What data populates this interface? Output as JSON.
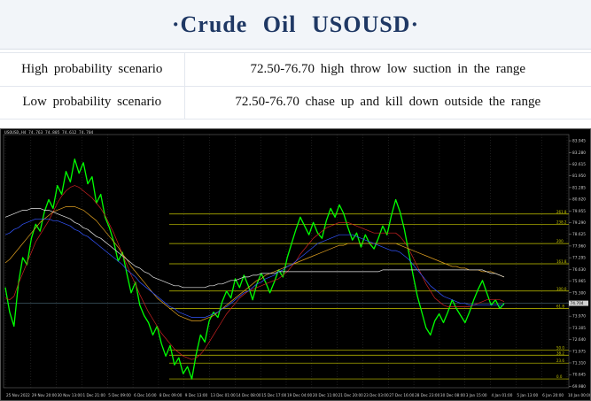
{
  "header": {
    "title": "·Crude Oil USOUSD·"
  },
  "scenarios": [
    {
      "label": "High probability scenario",
      "value": "72.50-76.70 high throw low suction in the range"
    },
    {
      "label": "Low probability scenario",
      "value": "72.50-76.70 chase up and kill down outside the range"
    }
  ],
  "chart_data": {
    "type": "line",
    "header_text": "USOUSD,H4 74.763 74.805 74.612 74.704",
    "colors": {
      "background": "#000000",
      "price": "#00ff00",
      "ma_red": "#cc2222",
      "ma_blue": "#3355ff",
      "ma_orange": "#e0a020",
      "ma_white": "#e8e8e8",
      "fib": "#c8c800",
      "grid": "#3a3a3a",
      "current_price": "#4a6a7a"
    },
    "ylim": [
      69.9,
      84.3
    ],
    "y_ticks": [
      "83.945",
      "83.280",
      "82.615",
      "81.950",
      "81.285",
      "80.620",
      "79.955",
      "79.290",
      "78.625",
      "77.960",
      "77.295",
      "76.630",
      "75.965",
      "75.300",
      "74.635",
      "73.970",
      "73.305",
      "72.640",
      "71.975",
      "71.310",
      "70.645",
      "69.980"
    ],
    "current_price": 74.704,
    "x_ticks": [
      "25 Nov 2022",
      "29 Nov 20:00",
      "30 Nov 13:00",
      "1 Dec 21:00",
      "5 Dec 09:00",
      "6 Dec 16:00",
      "8 Dec 09:00",
      "9 Dec 13:00",
      "13 Dec 01:00",
      "14 Dec 08:00",
      "15 Dec 17:00",
      "19 Dec 04:00",
      "20 Dec 11:00",
      "21 Dec 20:00",
      "23 Dec 03:00",
      "27 Dec 16:00",
      "28 Dec 23:00",
      "30 Dec 08:00",
      "3 Jan 15:00",
      "4 Jan 01:00",
      "5 Jan 13:00",
      "6 Jan 20:00",
      "10 Jan 00:00"
    ],
    "fib_levels": [
      {
        "label": "261.8",
        "y": 79.78
      },
      {
        "label": "238.2",
        "y": 79.2
      },
      {
        "label": "200",
        "y": 78.1
      },
      {
        "label": "161.8",
        "y": 76.95
      },
      {
        "label": "100.0",
        "y": 75.4
      },
      {
        "label": "61.8",
        "y": 74.4
      },
      {
        "label": "50.0",
        "y": 72.05
      },
      {
        "label": "38.2",
        "y": 71.75
      },
      {
        "label": "23.6",
        "y": 71.3
      },
      {
        "label": "0.0",
        "y": 70.4
      }
    ],
    "series": [
      {
        "values": [
          75.6,
          74.2,
          73.4,
          75.8,
          77.3,
          76.9,
          78.4,
          79.2,
          78.8,
          79.9,
          80.6,
          80.1,
          81.4,
          80.9,
          82.2,
          81.6,
          82.9,
          82.1,
          82.7,
          81.5,
          81.9,
          80.4,
          80.9,
          79.6,
          79.0,
          78.2,
          77.1,
          77.6,
          76.4,
          75.3,
          75.9,
          74.6,
          74.0,
          73.6,
          72.9,
          73.4,
          72.4,
          71.7,
          72.3,
          71.2,
          71.6,
          70.7,
          71.1,
          70.4,
          71.8,
          72.9,
          72.5,
          73.7,
          74.2,
          73.9,
          74.8,
          75.4,
          75.0,
          76.1,
          75.6,
          76.3,
          75.7,
          74.9,
          75.8,
          76.4,
          75.9,
          75.3,
          75.9,
          76.6,
          76.2,
          77.3,
          78.1,
          78.9,
          79.6,
          79.1,
          78.6,
          79.3,
          78.7,
          78.4,
          79.4,
          80.1,
          79.6,
          80.3,
          79.8,
          79.0,
          78.3,
          78.7,
          77.9,
          78.6,
          78.1,
          77.8,
          78.4,
          79.1,
          78.6,
          79.7,
          80.6,
          79.9,
          78.9,
          77.6,
          76.3,
          75.1,
          74.2,
          73.3,
          72.9,
          73.7,
          74.1,
          73.6,
          74.2,
          74.9,
          74.4,
          74.0,
          73.6,
          74.2,
          74.9,
          75.5,
          76.0,
          75.3,
          74.6,
          74.9,
          74.4,
          74.7
        ]
      },
      {
        "name": "",
        "values": [
          75.0,
          74.9,
          75.1,
          75.8,
          76.4,
          77.0,
          77.6,
          78.2,
          78.6,
          79.0,
          79.4,
          79.9,
          80.4,
          80.8,
          81.1,
          81.3,
          81.4,
          81.3,
          81.1,
          80.9,
          80.7,
          80.4,
          80.1,
          79.7,
          79.2,
          78.7,
          78.1,
          77.5,
          76.9,
          76.3,
          75.8,
          75.2,
          74.7,
          74.2,
          73.8,
          73.4,
          73.0,
          72.7,
          72.4,
          72.1,
          71.9,
          71.7,
          71.6,
          71.5,
          71.6,
          71.8,
          72.1,
          72.5,
          72.9,
          73.3,
          73.7,
          74.1,
          74.4,
          74.7,
          75.0,
          75.2,
          75.4,
          75.5,
          75.6,
          75.7,
          75.8,
          75.9,
          76.0,
          76.1,
          76.3,
          76.5,
          76.8,
          77.1,
          77.5,
          77.8,
          78.1,
          78.4,
          78.6,
          78.8,
          79.0,
          79.1,
          79.2,
          79.3,
          79.3,
          79.3,
          79.2,
          79.1,
          79.0,
          78.9,
          78.8,
          78.7,
          78.7,
          78.7,
          78.7,
          78.7,
          78.7,
          78.5,
          78.2,
          77.8,
          77.3,
          76.8,
          76.3,
          75.8,
          75.4,
          75.0,
          74.8,
          74.6,
          74.5,
          74.5,
          74.5,
          74.5,
          74.5,
          74.5,
          74.6,
          74.7,
          74.8,
          74.9,
          74.9,
          74.9,
          74.9,
          74.8
        ]
      },
      {
        "name": "",
        "values": [
          77.0,
          77.2,
          77.5,
          77.8,
          78.1,
          78.4,
          78.7,
          79.0,
          79.3,
          79.5,
          79.7,
          79.9,
          80.0,
          80.1,
          80.2,
          80.2,
          80.2,
          80.1,
          80.0,
          79.8,
          79.6,
          79.4,
          79.1,
          78.8,
          78.5,
          78.2,
          77.9,
          77.5,
          77.2,
          76.8,
          76.5,
          76.2,
          75.9,
          75.6,
          75.3,
          75.0,
          74.8,
          74.6,
          74.4,
          74.2,
          74.0,
          73.9,
          73.8,
          73.7,
          73.7,
          73.7,
          73.8,
          73.9,
          74.0,
          74.2,
          74.4,
          74.6,
          74.8,
          75.0,
          75.2,
          75.4,
          75.6,
          75.8,
          76.0,
          76.1,
          76.3,
          76.4,
          76.5,
          76.6,
          76.7,
          76.8,
          76.9,
          77.0,
          77.1,
          77.2,
          77.3,
          77.4,
          77.5,
          77.6,
          77.7,
          77.8,
          77.9,
          78.0,
          78.0,
          78.1,
          78.1,
          78.1,
          78.1,
          78.1,
          78.1,
          78.1,
          78.1,
          78.1,
          78.1,
          78.1,
          78.1,
          78.0,
          77.9,
          77.8,
          77.7,
          77.6,
          77.5,
          77.4,
          77.3,
          77.2,
          77.1,
          77.0,
          76.9,
          76.8,
          76.8,
          76.7,
          76.7,
          76.6,
          76.6,
          76.6,
          76.5,
          76.5,
          76.5,
          76.4,
          76.3,
          76.2
        ]
      },
      {
        "name": "",
        "values": [
          79.6,
          79.7,
          79.8,
          79.9,
          80.0,
          80.0,
          80.1,
          80.1,
          80.1,
          80.0,
          80.0,
          79.9,
          79.8,
          79.7,
          79.6,
          79.5,
          79.3,
          79.2,
          79.0,
          78.9,
          78.7,
          78.5,
          78.4,
          78.2,
          78.0,
          77.8,
          77.6,
          77.4,
          77.2,
          77.0,
          76.8,
          76.7,
          76.5,
          76.4,
          76.2,
          76.1,
          76.0,
          75.9,
          75.8,
          75.7,
          75.7,
          75.6,
          75.6,
          75.6,
          75.6,
          75.6,
          75.6,
          75.7,
          75.7,
          75.8,
          75.8,
          75.9,
          76.0,
          76.0,
          76.1,
          76.2,
          76.2,
          76.3,
          76.3,
          76.4,
          76.4,
          76.4,
          76.4,
          76.5,
          76.5,
          76.5,
          76.5,
          76.5,
          76.5,
          76.5,
          76.5,
          76.5,
          76.5,
          76.5,
          76.5,
          76.5,
          76.5,
          76.5,
          76.5,
          76.5,
          76.5,
          76.5,
          76.5,
          76.5,
          76.5,
          76.5,
          76.5,
          76.6,
          76.6,
          76.6,
          76.6,
          76.6,
          76.6,
          76.6,
          76.6,
          76.6,
          76.6,
          76.6,
          76.6,
          76.6,
          76.6,
          76.6,
          76.6,
          76.6,
          76.6,
          76.6,
          76.6,
          76.6,
          76.6,
          76.6,
          76.6,
          76.5,
          76.4,
          76.4,
          76.3,
          76.2
        ]
      },
      {
        "name": "",
        "values": [
          78.6,
          78.7,
          78.9,
          79.0,
          79.2,
          79.3,
          79.4,
          79.5,
          79.5,
          79.5,
          79.5,
          79.4,
          79.4,
          79.3,
          79.2,
          79.1,
          78.9,
          78.8,
          78.6,
          78.5,
          78.3,
          78.1,
          77.9,
          77.7,
          77.5,
          77.3,
          77.1,
          76.9,
          76.6,
          76.4,
          76.2,
          75.9,
          75.7,
          75.5,
          75.3,
          75.1,
          74.9,
          74.7,
          74.5,
          74.4,
          74.2,
          74.1,
          74.0,
          73.9,
          73.9,
          73.9,
          73.9,
          74.0,
          74.1,
          74.2,
          74.4,
          74.5,
          74.7,
          74.9,
          75.1,
          75.3,
          75.4,
          75.6,
          75.8,
          75.9,
          76.1,
          76.2,
          76.3,
          76.5,
          76.6,
          76.8,
          76.9,
          77.1,
          77.3,
          77.5,
          77.7,
          77.9,
          78.1,
          78.2,
          78.3,
          78.4,
          78.5,
          78.6,
          78.6,
          78.6,
          78.6,
          78.5,
          78.4,
          78.3,
          78.2,
          78.1,
          78.0,
          77.9,
          77.8,
          77.7,
          77.7,
          77.6,
          77.4,
          77.2,
          76.9,
          76.6,
          76.3,
          76.0,
          75.7,
          75.5,
          75.3,
          75.1,
          75.0,
          74.9,
          74.8,
          74.7,
          74.7,
          74.6,
          74.6,
          74.6,
          74.6,
          74.6,
          74.6,
          74.6,
          74.6,
          74.6
        ]
      }
    ]
  }
}
